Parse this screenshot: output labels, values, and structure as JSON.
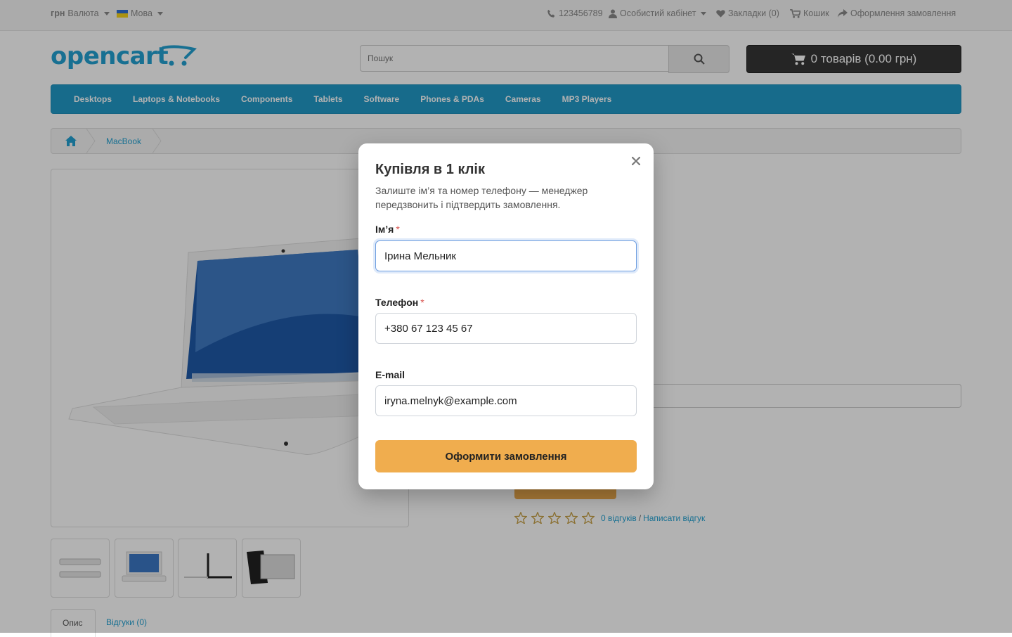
{
  "topbar": {
    "currency_symbol": "грн",
    "currency_label": "Валюта",
    "language_label": "Мова",
    "phone": "123456789",
    "account": "Особистий кабінет",
    "wishlist": "Закладки (0)",
    "cart": "Кошик",
    "checkout": "Оформлення замовлення"
  },
  "header": {
    "logo": "opencart",
    "search_placeholder": "Пошук",
    "cart_button": "0 товарів (0.00 грн)"
  },
  "menu": [
    "Desktops",
    "Laptops & Notebooks",
    "Components",
    "Tablets",
    "Software",
    "Phones & PDAs",
    "Cameras",
    "MP3 Players"
  ],
  "breadcrumb": {
    "current": "MacBook"
  },
  "product": {
    "reviews_link": "0 відгуків",
    "separator": "/",
    "write_review": "Написати відгук",
    "rating_stars": 0,
    "rating_max": 5
  },
  "tabs": {
    "description": "Опис",
    "reviews": "Відгуки (0)"
  },
  "modal": {
    "title": "Купівля в 1 клік",
    "subtitle": "Залиште ім’я та номер телефону — менеджер передзвонить і підтвердить замовлення.",
    "name_label": "Ім’я",
    "name_value": "Ірина Мельник",
    "phone_label": "Телефон",
    "phone_value": "+380 67 123 45 67",
    "email_label": "E-mail",
    "email_value": "iryna.melnyk@example.com",
    "required_mark": "*",
    "submit": "Оформити замовлення"
  },
  "colors": {
    "brand": "#229ac8",
    "accent_button": "#f0ad4e",
    "required": "#d9534f"
  }
}
